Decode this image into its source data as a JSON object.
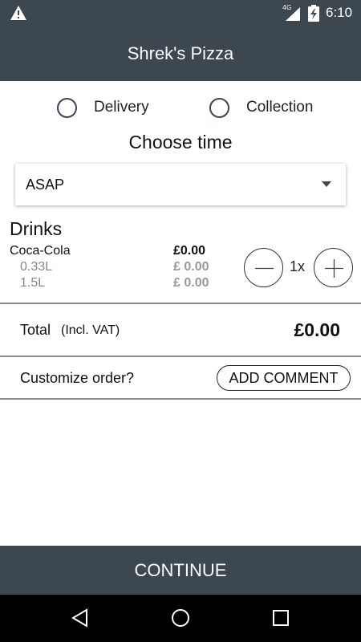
{
  "status_bar": {
    "network": "4G",
    "time": "6:10",
    "icons": [
      "warning-icon",
      "signal-icon",
      "battery-charging-icon"
    ]
  },
  "app_bar": {
    "title": "Shrek's Pizza"
  },
  "order_type": {
    "options": [
      {
        "label": "Delivery",
        "selected": false
      },
      {
        "label": "Collection",
        "selected": false
      }
    ]
  },
  "choose_time": {
    "heading": "Choose time",
    "selected_value": "ASAP"
  },
  "drinks": {
    "title": "Drinks",
    "product": {
      "name": "Coca-Cola",
      "price": "£0.00",
      "variants": [
        {
          "name": "0.33L",
          "price": "£ 0.00"
        },
        {
          "name": "1.5L",
          "price": "£ 0.00"
        }
      ],
      "quantity": "1x"
    }
  },
  "total": {
    "label": "Total",
    "note": "(Incl. VAT)",
    "value": "£0.00"
  },
  "customize": {
    "label": "Customize order?",
    "button_label": "ADD COMMENT"
  },
  "footer": {
    "continue_label": "CONTINUE"
  },
  "colors": {
    "bar_background": "#3d4750",
    "nav_background": "#000000",
    "muted_text": "#888888"
  }
}
